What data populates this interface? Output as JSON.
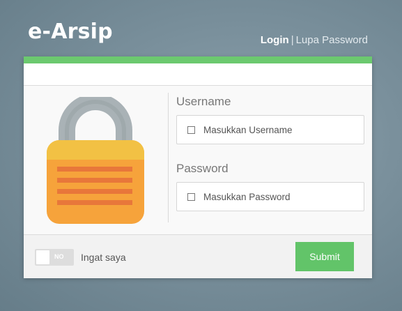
{
  "brand": {
    "title": "e-Arsip"
  },
  "nav": {
    "login": "Login",
    "separator": "|",
    "forgot": "Lupa Password"
  },
  "form": {
    "username_label": "Username",
    "username_placeholder": "Masukkan Username",
    "password_label": "Password",
    "password_placeholder": "Masukkan Password"
  },
  "footer": {
    "toggle_state": "NO",
    "remember_label": "Ingat saya",
    "submit_label": "Submit"
  },
  "colors": {
    "accent": "#6cc96f",
    "submit": "#62c469",
    "lock_body": "#f6a33b",
    "lock_shackle": "#a9b2b6"
  },
  "icons": {
    "lock": "padlock-illustration",
    "field": "square-outline-icon"
  }
}
